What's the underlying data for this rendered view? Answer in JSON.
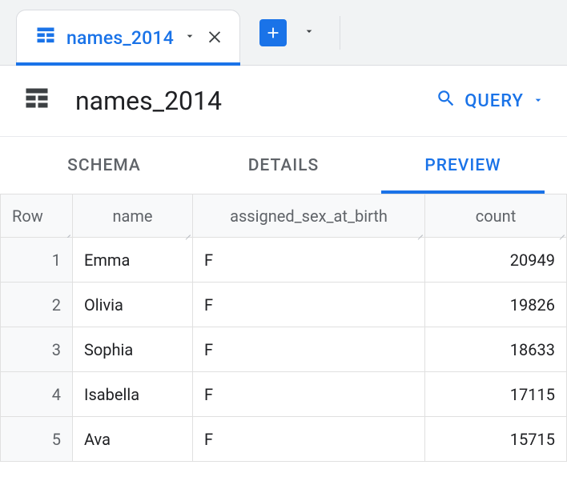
{
  "tab": {
    "label": "names_2014"
  },
  "header": {
    "title": "names_2014",
    "query_label": "QUERY"
  },
  "subtabs": {
    "schema": "SCHEMA",
    "details": "DETAILS",
    "preview": "PREVIEW",
    "active": "preview"
  },
  "table": {
    "columns": {
      "row": "Row",
      "name": "name",
      "assigned_sex_at_birth": "assigned_sex_at_birth",
      "count": "count"
    },
    "rows": [
      {
        "row": "1",
        "name": "Emma",
        "assigned_sex_at_birth": "F",
        "count": "20949"
      },
      {
        "row": "2",
        "name": "Olivia",
        "assigned_sex_at_birth": "F",
        "count": "19826"
      },
      {
        "row": "3",
        "name": "Sophia",
        "assigned_sex_at_birth": "F",
        "count": "18633"
      },
      {
        "row": "4",
        "name": "Isabella",
        "assigned_sex_at_birth": "F",
        "count": "17115"
      },
      {
        "row": "5",
        "name": "Ava",
        "assigned_sex_at_birth": "F",
        "count": "15715"
      }
    ]
  }
}
